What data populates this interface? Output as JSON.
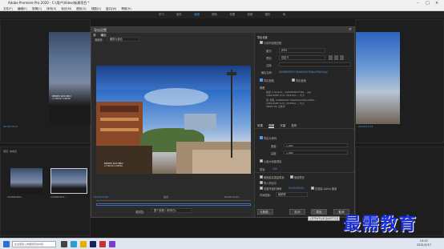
{
  "app": {
    "title": "Adobe Premiere Pro 2020 - C:\\用户\\Video\\新建项目 *",
    "menu": [
      "文件(F)",
      "编辑(E)",
      "剪辑(C)",
      "序列(S)",
      "标记(M)",
      "图形(G)",
      "视图(V)",
      "窗口(W)",
      "帮助(H)"
    ]
  },
  "workspaces": [
    "学习",
    "组件",
    "编辑",
    "颜色",
    "效果",
    "音频",
    "图形",
    "库"
  ],
  "active_workspace": "编辑",
  "left_panel": {
    "timecode": "00;00;33;22",
    "project_label": "项目: 未命名",
    "clip1": "2A068C601…",
    "clip2": "2A068C601…",
    "camera_caption": "REDMI K20 PRO",
    "camera_caption2": "AI TRIPLE CAMERA"
  },
  "right_panel": {
    "timecode": "00;00;33;22"
  },
  "dialog": {
    "title": "导出设置",
    "close": "×",
    "tabs": [
      "源",
      "输出"
    ],
    "source_scaling_label": "源缩放:",
    "source_scaling_value": "缩放以适合",
    "preview_caption": "REDMI K20 PRO",
    "preview_caption2": "AI TRIPLE CAMERA",
    "timecode_left": "00;00;00;00",
    "timecode_right": "00;00;33;22",
    "zoom": "适合",
    "source_range_label": "源范围:",
    "source_range_value": "整个剪辑 / 序列切入",
    "export_settings": {
      "header": "导出设置",
      "match_sequence": "与序列设置匹配",
      "format_label": "格式:",
      "format_value": "JPEG",
      "preset_label": "预设:",
      "preset_value": "自定义",
      "comments_label": "注释:",
      "output_name_label": "输出名称:",
      "output_name_value": "2A068C601718a6d0e764bce35b0.jpg",
      "export_video": "导出视频",
      "export_audio": "导出音频",
      "summary_label": "摘要",
      "summary_output": "输出: C:\\Users\\… 2A068C601718a…  .jpg",
      "summary_output2": "1920x1080 (1.0), 29.97fps … 大小",
      "summary_source": "源: 剪辑, 2A068C601718a6d0e764bce35b0…",
      "summary_source2": "1920x1080 (1.0), 29.97fps … 大小",
      "summary_source3": "48000 Hz, 立体声"
    },
    "output_tabs": [
      "效果",
      "视频",
      "字幕",
      "发布"
    ],
    "video": {
      "export_as_sequence": "导出为序列",
      "width_label": "宽度:",
      "width_value": "1,920",
      "height_label": "高度:",
      "height_value": "1,080",
      "max_depth": "以最大深度渲染",
      "quality_label": "质量:",
      "quality_value": "100"
    },
    "bottom_options": {
      "max_render": "使用最高渲染质量",
      "use_preview": "使用预览",
      "import_project": "导入项目中",
      "set_start_timecode": "设置开始时间码",
      "start_timecode": "00;00;00;00",
      "render_alpha": "仅渲染 Alpha 通道",
      "interpolation_label": "时间插值:",
      "interpolation_value": "帧采样"
    },
    "buttons": {
      "metadata": "元数据...",
      "queue": "队列",
      "export": "导出",
      "cancel": "取消"
    },
    "export_tooltip": "立即开始导出所选的所有项目"
  },
  "taskbar": {
    "search_text": "在这里输入你要搜索的内容",
    "time": "13:07",
    "date": "2021/5/17"
  },
  "watermark": "最需教育"
}
